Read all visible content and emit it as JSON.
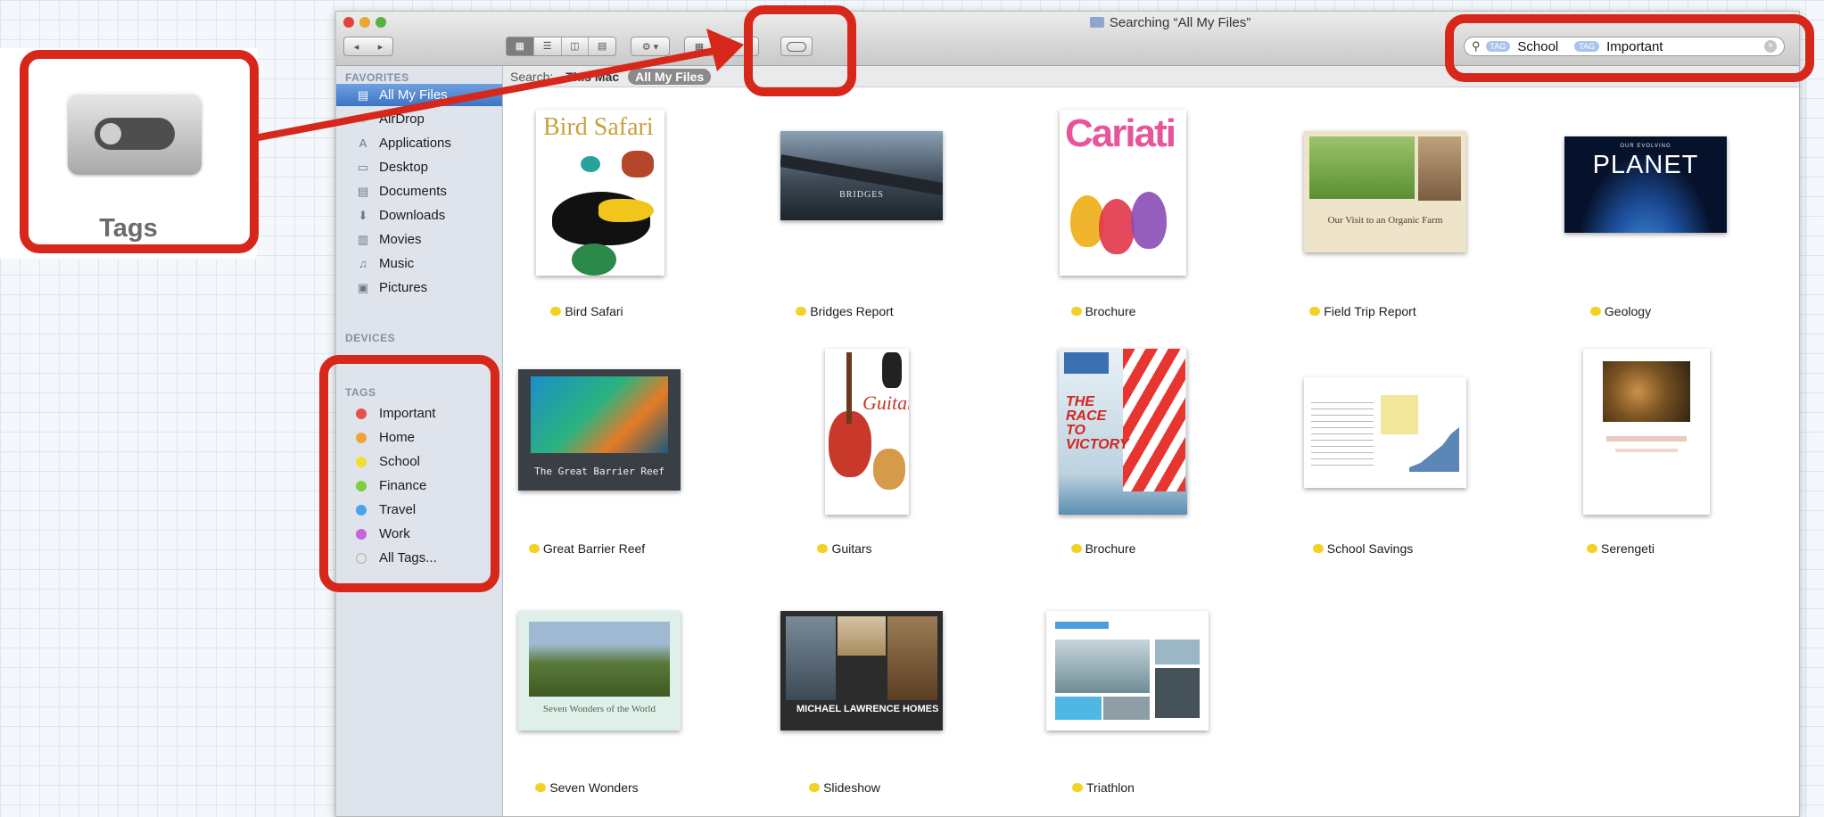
{
  "window": {
    "title": "Searching “All My Files”",
    "toolbar": {
      "nav_back": "◂",
      "nav_forward": "▸",
      "view_buttons": [
        "▦",
        "☰",
        "◫",
        "▤"
      ],
      "arrange_label": "⚙ ▾",
      "share_label": "",
      "edit_label": ""
    },
    "search": {
      "tokens": [
        {
          "type": "TAG",
          "value": "School"
        },
        {
          "type": "TAG",
          "value": "Important"
        }
      ],
      "clear": "×"
    }
  },
  "scope_bar": {
    "label": "Search:",
    "this_mac": "This Mac",
    "all_my_files": "All My Files"
  },
  "sidebar": {
    "favorites_header": "FAVORITES",
    "favorites": [
      {
        "label": "All My Files",
        "icon": "all-files-icon",
        "glyph": "▤"
      },
      {
        "label": "AirDrop",
        "icon": "airdrop-icon",
        "glyph": "◌"
      },
      {
        "label": "Applications",
        "icon": "applications-icon",
        "glyph": "A"
      },
      {
        "label": "Desktop",
        "icon": "desktop-icon",
        "glyph": "▭"
      },
      {
        "label": "Documents",
        "icon": "documents-icon",
        "glyph": "▤"
      },
      {
        "label": "Downloads",
        "icon": "downloads-icon",
        "glyph": "⬇"
      },
      {
        "label": "Movies",
        "icon": "movies-icon",
        "glyph": "▥"
      },
      {
        "label": "Music",
        "icon": "music-icon",
        "glyph": "♫"
      },
      {
        "label": "Pictures",
        "icon": "pictures-icon",
        "glyph": "▣"
      }
    ],
    "devices_header": "DEVICES",
    "tags_header": "TAGS",
    "tags": [
      {
        "label": "Important",
        "color": "#e8504b"
      },
      {
        "label": "Home",
        "color": "#f2a23a"
      },
      {
        "label": "School",
        "color": "#f1de2e"
      },
      {
        "label": "Finance",
        "color": "#7ccf3f"
      },
      {
        "label": "Travel",
        "color": "#4aa3e8"
      },
      {
        "label": "Work",
        "color": "#c565d8"
      },
      {
        "label": "All Tags...",
        "color": "#e3e3e3"
      }
    ]
  },
  "files": [
    {
      "name": "Bird Safari",
      "thumb_title": "Bird Safari",
      "tag_color": "#f3d224"
    },
    {
      "name": "Bridges Report",
      "thumb_title": "BRIDGES",
      "tag_color": "#f3d224"
    },
    {
      "name": "Brochure",
      "thumb_title": "Cariati",
      "tag_color": "#f3d224"
    },
    {
      "name": "Field Trip Report",
      "thumb_title": "Our Visit to an Organic Farm",
      "tag_color": "#f3d224"
    },
    {
      "name": "Geology",
      "thumb_title": "PLANET",
      "thumb_subtitle": "OUR EVOLVING",
      "tag_color": "#f3d224"
    },
    {
      "name": "Great Barrier Reef",
      "thumb_title": "The Great Barrier Reef",
      "tag_color": "#f3d224"
    },
    {
      "name": "Guitars",
      "thumb_title": "Guitars",
      "tag_color": "#f3d224"
    },
    {
      "name": "Brochure",
      "thumb_title": "THE RACE TO VICTORY",
      "tag_color": "#f3d224"
    },
    {
      "name": "School Savings",
      "thumb_title": "",
      "tag_color": "#f3d224"
    },
    {
      "name": "Serengeti",
      "thumb_title": "",
      "tag_color": "#f3d224"
    },
    {
      "name": "Seven Wonders",
      "thumb_title": "Seven Wonders of the World",
      "tag_color": "#f3d224"
    },
    {
      "name": "Slideshow",
      "thumb_title": "MICHAEL LAWRENCE HOMES",
      "tag_color": "#f3d224"
    },
    {
      "name": "Triathlon",
      "thumb_title": "",
      "tag_color": "#f3d224"
    }
  ],
  "callout": {
    "label": "Tags"
  },
  "colors": {
    "annotation_red": "#d7261a",
    "selection_blue": "#3d74c4",
    "finder_tag_yellow": "#f3d224"
  }
}
